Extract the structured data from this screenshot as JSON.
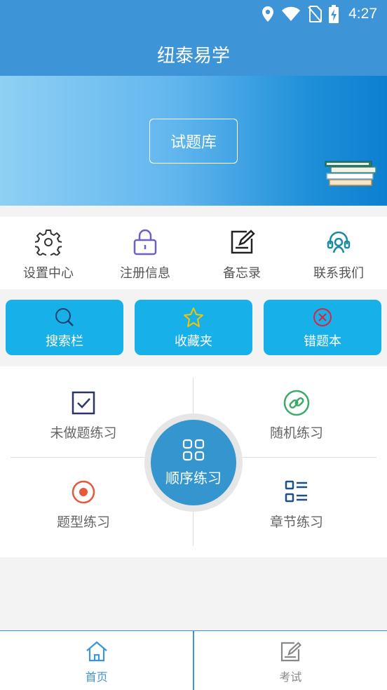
{
  "status_bar": {
    "time": "4:27",
    "icons": [
      "location-icon",
      "wifi-icon",
      "no-sim-icon",
      "battery-charging-icon"
    ]
  },
  "header": {
    "title": "纽泰易学"
  },
  "banner": {
    "button_label": "试题库",
    "image": "books-icon"
  },
  "quick_menu": [
    {
      "label": "设置中心",
      "icon": "gear-icon"
    },
    {
      "label": "注册信息",
      "icon": "lock-icon"
    },
    {
      "label": "备忘录",
      "icon": "memo-edit-icon"
    },
    {
      "label": "联系我们",
      "icon": "headset-icon"
    }
  ],
  "tools": [
    {
      "label": "搜索栏",
      "icon": "search-icon"
    },
    {
      "label": "收藏夹",
      "icon": "star-icon"
    },
    {
      "label": "错题本",
      "icon": "close-circle-icon"
    }
  ],
  "practice": {
    "undone": {
      "label": "未做题练习",
      "icon": "checkbox-icon"
    },
    "random": {
      "label": "随机练习",
      "icon": "link-icon"
    },
    "type": {
      "label": "题型练习",
      "icon": "record-icon"
    },
    "chapter": {
      "label": "章节练习",
      "icon": "list-icon"
    },
    "sequential": {
      "label": "顺序练习",
      "icon": "grid-icon"
    }
  },
  "bottom_nav": [
    {
      "label": "首页",
      "icon": "home-icon",
      "active": true
    },
    {
      "label": "考试",
      "icon": "exam-icon",
      "active": false
    }
  ],
  "colors": {
    "header": "#3d94d6",
    "tool_button": "#17b0e8",
    "center_button": "#3596cf",
    "active_nav": "#3d94d6",
    "inactive_nav": "#888888"
  }
}
